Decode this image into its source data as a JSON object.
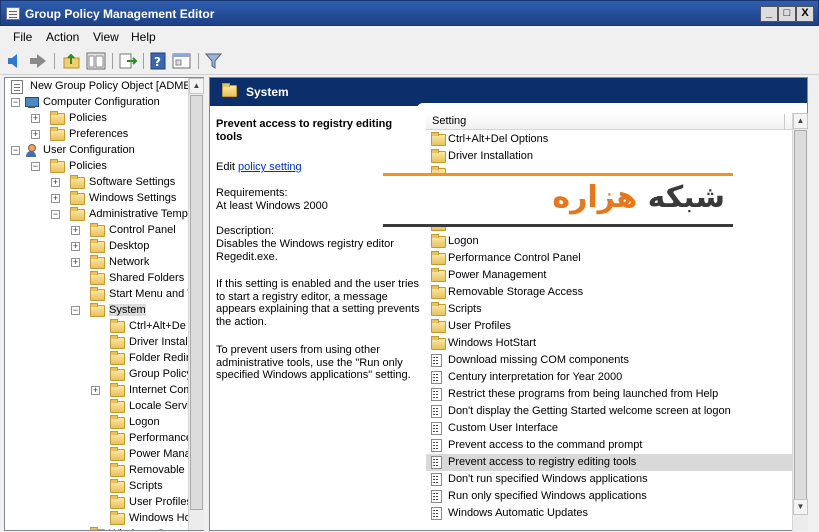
{
  "window": {
    "title": "Group Policy Management Editor",
    "buttons": [
      "_",
      "□",
      "X"
    ]
  },
  "menu": [
    "File",
    "Action",
    "View",
    "Help"
  ],
  "toolbar": {
    "icons": [
      "back-arrow-icon",
      "forward-arrow-icon",
      "up-folder-icon",
      "show-hide-tree-icon",
      "export-list-icon",
      "help-icon",
      "properties-icon",
      "filter-icon"
    ]
  },
  "tree": [
    {
      "label": "New Group Policy Object [ADME",
      "icon": "gpo-doc-icon",
      "level": 0,
      "expander": ""
    },
    {
      "label": "Computer Configuration",
      "icon": "computer-icon",
      "level": 0,
      "expander": "-"
    },
    {
      "label": "Policies",
      "icon": "folder-icon",
      "level": 1,
      "expander": "+"
    },
    {
      "label": "Preferences",
      "icon": "folder-icon",
      "level": 1,
      "expander": "+"
    },
    {
      "label": "User Configuration",
      "icon": "user-icon",
      "level": 0,
      "expander": "-"
    },
    {
      "label": "Policies",
      "icon": "folder-icon",
      "level": 1,
      "expander": "-"
    },
    {
      "label": "Software Settings",
      "icon": "folder-icon",
      "level": 2,
      "expander": "+"
    },
    {
      "label": "Windows Settings",
      "icon": "folder-icon",
      "level": 2,
      "expander": "+"
    },
    {
      "label": "Administrative Temp",
      "icon": "folder-icon",
      "level": 2,
      "expander": "-"
    },
    {
      "label": "Control Panel",
      "icon": "folder-icon",
      "level": 3,
      "expander": "+"
    },
    {
      "label": "Desktop",
      "icon": "folder-icon",
      "level": 3,
      "expander": "+"
    },
    {
      "label": "Network",
      "icon": "folder-icon",
      "level": 3,
      "expander": "+"
    },
    {
      "label": "Shared Folders",
      "icon": "folder-icon",
      "level": 3,
      "expander": ""
    },
    {
      "label": "Start Menu and T",
      "icon": "folder-icon",
      "level": 3,
      "expander": ""
    },
    {
      "label": "System",
      "icon": "folder-icon",
      "level": 3,
      "expander": "-",
      "selected": true
    },
    {
      "label": "Ctrl+Alt+De",
      "icon": "folder-icon",
      "level": 4,
      "expander": ""
    },
    {
      "label": "Driver Instal",
      "icon": "folder-icon",
      "level": 4,
      "expander": ""
    },
    {
      "label": "Folder Redire",
      "icon": "folder-icon",
      "level": 4,
      "expander": ""
    },
    {
      "label": "Group Policy",
      "icon": "folder-icon",
      "level": 4,
      "expander": ""
    },
    {
      "label": "Internet Com",
      "icon": "folder-icon",
      "level": 4,
      "expander": "+"
    },
    {
      "label": "Locale Servic",
      "icon": "folder-icon",
      "level": 4,
      "expander": ""
    },
    {
      "label": "Logon",
      "icon": "folder-icon",
      "level": 4,
      "expander": ""
    },
    {
      "label": "Performance",
      "icon": "folder-icon",
      "level": 4,
      "expander": ""
    },
    {
      "label": "Power Mana",
      "icon": "folder-icon",
      "level": 4,
      "expander": ""
    },
    {
      "label": "Removable S",
      "icon": "folder-icon",
      "level": 4,
      "expander": ""
    },
    {
      "label": "Scripts",
      "icon": "folder-icon",
      "level": 4,
      "expander": ""
    },
    {
      "label": "User Profiles",
      "icon": "folder-icon",
      "level": 4,
      "expander": ""
    },
    {
      "label": "Windows Ho",
      "icon": "folder-icon",
      "level": 4,
      "expander": ""
    },
    {
      "label": "Windows Co",
      "icon": "folder-icon",
      "level": 3,
      "expander": "+"
    }
  ],
  "header": {
    "title": "System"
  },
  "description": {
    "title": "Prevent access to registry editing tools",
    "edit_prefix": "Edit",
    "edit_link": "policy setting",
    "requirements_label": "Requirements:",
    "requirements_value": "At least Windows 2000",
    "description_label": "Description:",
    "description_value": "Disables the Windows registry editor Regedit.exe.",
    "para1": "If this setting is enabled and the user tries to start a registry editor, a message appears explaining that a setting prevents the action.",
    "para2": "To prevent users from using other administrative tools, use the \"Run only specified Windows applications\" setting."
  },
  "list": {
    "column_header": "Setting",
    "items": [
      {
        "label": "Ctrl+Alt+Del Options",
        "type": "folder"
      },
      {
        "label": "Driver Installation",
        "type": "folder"
      },
      {
        "label": "",
        "type": "folder",
        "hidden": true
      },
      {
        "label": "",
        "type": "folder",
        "hidden": true
      },
      {
        "label": "",
        "type": "folder",
        "hidden": true
      },
      {
        "label": "",
        "type": "folder",
        "hidden": true
      },
      {
        "label": "Logon",
        "type": "folder"
      },
      {
        "label": "Performance Control Panel",
        "type": "folder"
      },
      {
        "label": "Power Management",
        "type": "folder"
      },
      {
        "label": "Removable Storage Access",
        "type": "folder"
      },
      {
        "label": "Scripts",
        "type": "folder"
      },
      {
        "label": "User Profiles",
        "type": "folder"
      },
      {
        "label": "Windows HotStart",
        "type": "folder"
      },
      {
        "label": "Download missing COM components",
        "type": "policy"
      },
      {
        "label": "Century interpretation for Year 2000",
        "type": "policy"
      },
      {
        "label": "Restrict these programs from being launched from Help",
        "type": "policy"
      },
      {
        "label": "Don't display the Getting Started welcome screen at logon",
        "type": "policy"
      },
      {
        "label": "Custom User Interface",
        "type": "policy"
      },
      {
        "label": "Prevent access to the command prompt",
        "type": "policy"
      },
      {
        "label": "Prevent access to registry editing tools",
        "type": "policy",
        "selected": true
      },
      {
        "label": "Don't run specified Windows applications",
        "type": "policy"
      },
      {
        "label": "Run only specified Windows applications",
        "type": "policy"
      },
      {
        "label": "Windows Automatic Updates",
        "type": "policy"
      }
    ]
  },
  "watermark": {
    "dark_text": "شبکه",
    "orange_text": "هزاره",
    "accent": "#f39222"
  }
}
